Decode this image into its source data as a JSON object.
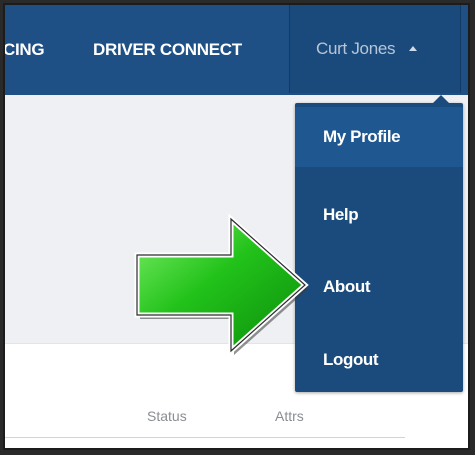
{
  "navbar": {
    "partial_item": "CING",
    "driver_connect": "DRIVER CONNECT",
    "user_name": "Curt Jones"
  },
  "dropdown": {
    "items": [
      {
        "label": "My Profile"
      },
      {
        "label": "Help"
      },
      {
        "label": "About"
      },
      {
        "label": "Logout"
      }
    ]
  },
  "table": {
    "columns": [
      "Status",
      "Attrs"
    ]
  },
  "annotation": {
    "arrow_color": "#22c21a",
    "arrow_icon": "green-right-arrow-icon"
  },
  "colors": {
    "navbar": "#1e5086",
    "dropdown": "#1b4b7c"
  }
}
